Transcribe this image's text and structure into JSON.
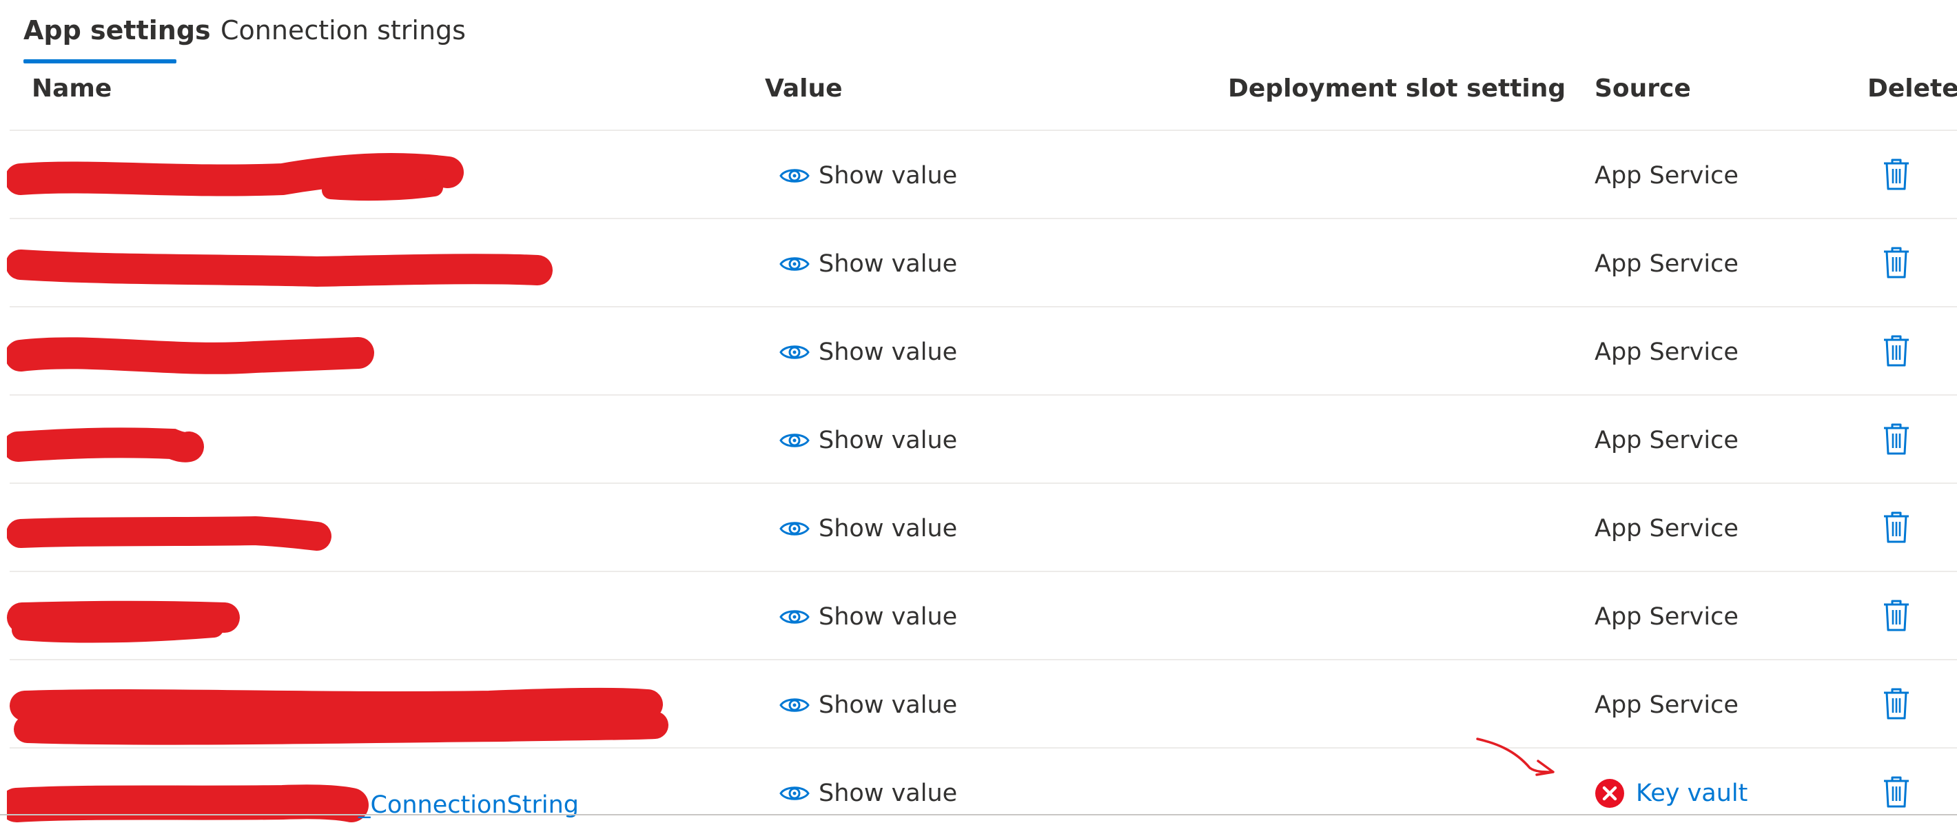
{
  "tabs": {
    "app_settings": "App settings",
    "connection_strings": "Connection strings"
  },
  "columns": {
    "name": "Name",
    "value": "Value",
    "deployment_slot_setting": "Deployment slot setting",
    "source": "Source",
    "delete": "Delete"
  },
  "rows": [
    {
      "name_suffix": "",
      "value": "Show value",
      "source": "App Service",
      "source_status": "ok"
    },
    {
      "name_suffix": "",
      "value": "Show value",
      "source": "App Service",
      "source_status": "ok"
    },
    {
      "name_suffix": "",
      "value": "Show value",
      "source": "App Service",
      "source_status": "ok"
    },
    {
      "name_suffix": "",
      "value": "Show value",
      "source": "App Service",
      "source_status": "ok"
    },
    {
      "name_suffix": "",
      "value": "Show value",
      "source": "App Service",
      "source_status": "ok"
    },
    {
      "name_suffix": "",
      "value": "Show value",
      "source": "App Service",
      "source_status": "ok"
    },
    {
      "name_suffix": "",
      "value": "Show value",
      "source": "App Service",
      "source_status": "ok"
    },
    {
      "name_suffix": "_ConnectionString",
      "value": "Show value",
      "source": "Key vault",
      "source_status": "error"
    }
  ],
  "colors": {
    "accent": "#0078d4",
    "error": "#e81123",
    "redaction": "#e31e24"
  },
  "icons": {
    "show_value": "eye-icon",
    "delete": "trash-icon",
    "error": "error-circle-icon"
  }
}
